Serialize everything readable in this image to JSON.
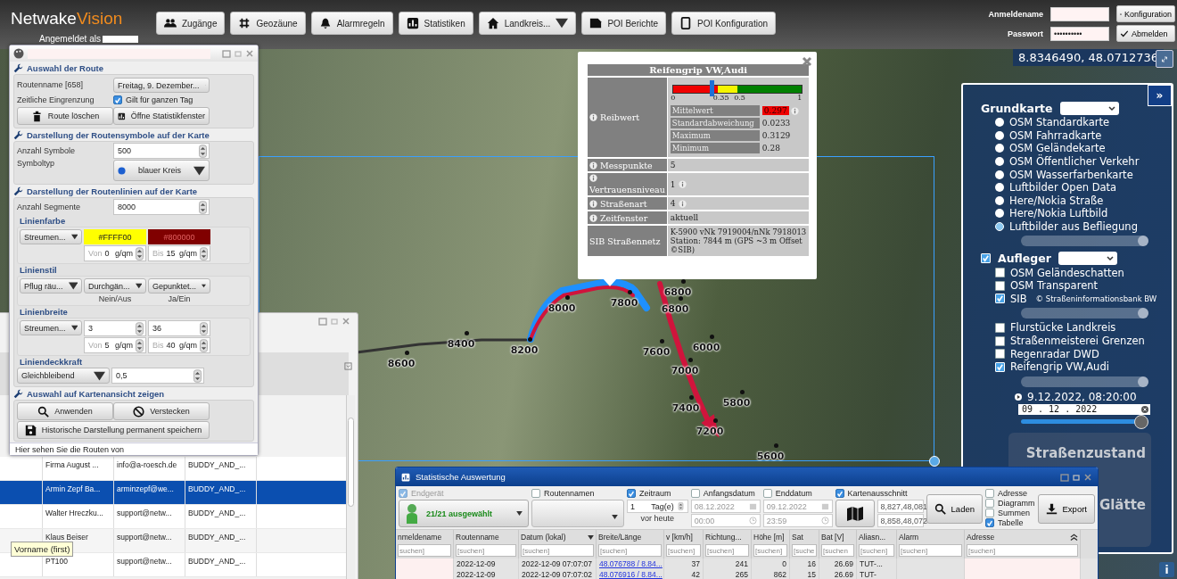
{
  "header": {
    "logo_main": "Netwake",
    "logo_accent": "Vision",
    "logged_in_label": "Angemeldet als",
    "nav": [
      {
        "label": "Zugänge",
        "dropdown": false
      },
      {
        "label": "Geozäune",
        "dropdown": false
      },
      {
        "label": "Alarmregeln",
        "dropdown": false
      },
      {
        "label": "Statistiken",
        "dropdown": false
      },
      {
        "label": "Landkreis...",
        "dropdown": true
      },
      {
        "label": "POI Berichte",
        "dropdown": false
      },
      {
        "label": "POI Konfiguration",
        "dropdown": false
      }
    ],
    "login": {
      "name_label": "Anmeldename",
      "password_label": "Passwort",
      "password_value": "••••••••••"
    },
    "buttons": [
      "Konfiguration",
      "Abmelden"
    ]
  },
  "map": {
    "coordinates": "8.8346490, 48.0712736",
    "route_labels": [
      "8600",
      "8400",
      "8200",
      "8000",
      "7800",
      "6800",
      "6800",
      "7600",
      "6000",
      "7000",
      "5800",
      "7400",
      "7200",
      "5600"
    ]
  },
  "route_panel": {
    "route_section": {
      "title": "Auswahl der Route",
      "route_name_label": "Routenname [658]",
      "route_value": "Freitag, 9. Dezember...",
      "time_label": "Zeitliche Eingrenzung",
      "whole_day": {
        "label": "Gilt für ganzen Tag",
        "checked": true
      },
      "buttons": [
        "Route löschen",
        "Öffne Statistikfenster"
      ]
    },
    "symbols_section": {
      "title": "Darstellung der Routensymbole auf der Karte",
      "count_label": "Anzahl Symbole",
      "count_value": "500",
      "type_label": "Symboltyp",
      "type_value": "blauer Kreis"
    },
    "lines_section": {
      "title": "Darstellung der Routenlinien auf der Karte",
      "segments_label": "Anzahl Segmente",
      "segments_value": "8000",
      "color": {
        "title": "Linienfarbe",
        "mode": "Streumen...",
        "from_color": "#FFFF00",
        "to_color": "#800000",
        "from": {
          "label": "Von",
          "value": "0",
          "unit": "g/qm"
        },
        "to": {
          "label": "Bis",
          "value": "15",
          "unit": "g/qm"
        }
      },
      "style": {
        "title": "Linienstil",
        "dropdowns": [
          "Pflug räu...",
          "Durchgän...",
          "Gepunktet..."
        ],
        "captions": [
          "Nein/Aus",
          "Ja/Ein"
        ]
      },
      "width": {
        "title": "Linienbreite",
        "mode": "Streumen...",
        "min_value": "3",
        "max_value": "36",
        "from": {
          "label": "Von",
          "value": "5",
          "unit": "g/qm"
        },
        "to": {
          "label": "Bis",
          "value": "40",
          "unit": "g/qm"
        }
      },
      "opacity": {
        "title": "Liniendeckkraft",
        "mode": "Gleichbleibend",
        "value": "0,5"
      }
    },
    "show_section": {
      "title": "Auswahl auf Kartenansicht zeigen",
      "buttons": [
        "Anwenden",
        "Verstecken"
      ],
      "save_button": "Historische Darstellung permanent speichern"
    },
    "footer": "Hier sehen Sie die Routen von"
  },
  "users_window": {
    "rows": [
      {
        "cells": [
          "Firma August ...",
          "info@a-roesch.de",
          "BUDDY_AND_..."
        ],
        "selected": false
      },
      {
        "cells": [
          "Armin Zepf Ba...",
          "arminzepf@we...",
          "BUDDY_AND_..."
        ],
        "selected": true
      },
      {
        "cells": [
          "Walter Hreczku...",
          "support@netw...",
          "BUDDY_AND_..."
        ],
        "selected": false
      },
      {
        "cells": [
          "Klaus Beiser",
          "support@netw...",
          "BUDDY_AND_..."
        ],
        "selected": false
      },
      {
        "cells": [
          "PT100",
          "support@netw...",
          "BUDDY_AND_..."
        ],
        "selected": false
      }
    ],
    "tooltip": "Vorname (first)"
  },
  "popup": {
    "title": "Reifengrip VW,Audi",
    "measure_label": "Reibwert",
    "gauge": {
      "ticks": [
        "0",
        "0.35",
        "0.5",
        "1"
      ],
      "level": 0.297
    },
    "stats": [
      {
        "label": "Mittelwert",
        "value": "0.297",
        "alert": true,
        "info": true
      },
      {
        "label": "Standardabweichung",
        "value": "0.0233",
        "alert": false,
        "info": false
      },
      {
        "label": "Maximum",
        "value": "0.3129",
        "alert": false,
        "info": false
      },
      {
        "label": "Minimum",
        "value": "0.28",
        "alert": false,
        "info": false
      }
    ],
    "rows": [
      {
        "label": "Messpunkte",
        "value": "5",
        "info": false
      },
      {
        "label": "Vertrauensniveau",
        "value": "1",
        "info": true
      },
      {
        "label": "Straßenart",
        "value": "4",
        "info": true
      },
      {
        "label": "Zeitfenster",
        "value": "aktuell",
        "info": false
      }
    ],
    "sib": {
      "label": "SIB Straßennetz",
      "lines": [
        "K-5900 vNk 7919004/nNk 7918013",
        "Station: 7844 m (GPS ~3 m Offset",
        "©SIB)"
      ]
    }
  },
  "layers_panel": {
    "collapse_button": "»",
    "base_title": "Grundkarte",
    "base_maps": [
      {
        "label": "OSM Standardkarte",
        "selected": false
      },
      {
        "label": "OSM Fahrradkarte",
        "selected": false
      },
      {
        "label": "OSM Geländekarte",
        "selected": false
      },
      {
        "label": "OSM Öffentlicher Verkehr",
        "selected": false
      },
      {
        "label": "OSM Wasserfarbenkarte",
        "selected": false
      },
      {
        "label": "Luftbilder Open Data",
        "selected": false
      },
      {
        "label": "Here/Nokia Straße",
        "selected": false
      },
      {
        "label": "Here/Nokia Luftbild",
        "selected": false
      },
      {
        "label": "Luftbilder aus Befliegung",
        "selected": true
      }
    ],
    "base_opacity": {
      "level": 1
    },
    "overlay_title": "Aufleger",
    "overlay_enabled": true,
    "overlays": [
      {
        "label": "OSM Geländeschatten",
        "checked": false
      },
      {
        "label": "OSM Transparent",
        "checked": false
      },
      {
        "label": "SIB",
        "note": "© Straßeninformationsbank BW",
        "checked": true,
        "level": 1
      },
      {
        "label": "Flurstücke Landkreis",
        "checked": false
      },
      {
        "label": "Straßenmeisterei Grenzen",
        "checked": false
      },
      {
        "label": "Regenradar DWD",
        "checked": false
      },
      {
        "label": "Reifengrip VW,Audi",
        "checked": true,
        "level": 1
      }
    ],
    "time": {
      "label": "9.12.2022, 08:20:00",
      "date_value": "09 . 12 . 2022",
      "level": 1
    },
    "legend": [
      "Straßenzustand",
      "Glätte"
    ]
  },
  "stats_window": {
    "title": "Statistische Auswertung",
    "device": {
      "label": "Endgerät",
      "checked": true,
      "disabled": true,
      "value": "21/21 ausgewählt"
    },
    "route_names": {
      "label": "Routennamen",
      "checked": false
    },
    "period": {
      "label": "Zeitraum",
      "checked": true,
      "value": "1",
      "unit": "Tag(e)",
      "caption": "vor heute"
    },
    "start": {
      "label": "Anfangsdatum",
      "checked": false,
      "date": "08.12.2022",
      "time": "00:00"
    },
    "end": {
      "label": "Enddatum",
      "checked": false,
      "date": "09.12.2022",
      "time": "23:59"
    },
    "extent": {
      "label": "Kartenausschnitt",
      "checked": true,
      "values": [
        "8,827,48,081",
        "8,858,48,072"
      ]
    },
    "load_button": "Laden",
    "options": [
      {
        "label": "Adresse",
        "checked": false
      },
      {
        "label": "Diagramm",
        "checked": false
      },
      {
        "label": "Summen",
        "checked": false
      },
      {
        "label": "Tabelle",
        "checked": true
      }
    ],
    "export_button": "Export",
    "columns": [
      {
        "label": "nmeldename",
        "placeholder": "suchen]",
        "sorted": false
      },
      {
        "label": "Routenname",
        "placeholder": "[suchen]",
        "sorted": false
      },
      {
        "label": "Datum (lokal)",
        "placeholder": "[suchen]",
        "sorted": true
      },
      {
        "label": "Breite/Länge",
        "placeholder": "[suchen]",
        "sorted": false
      },
      {
        "label": "v [km/h]",
        "placeholder": "[suchen]",
        "sorted": false
      },
      {
        "label": "Richtung...",
        "placeholder": "[suchen]",
        "sorted": false
      },
      {
        "label": "Höhe [m]",
        "placeholder": "[suchen]",
        "sorted": false
      },
      {
        "label": "Sat",
        "placeholder": "[suche",
        "sorted": false
      },
      {
        "label": "Bat [V]",
        "placeholder": "[suchen",
        "sorted": false
      },
      {
        "label": "Aliasn...",
        "placeholder": "[suchen]",
        "sorted": false
      },
      {
        "label": "Alarm",
        "placeholder": "[suchen]",
        "sorted": false
      },
      {
        "label": "Adresse",
        "placeholder": "[suchen]",
        "sorted": false
      }
    ],
    "rows": [
      {
        "cells": [
          "",
          "2022-12-09",
          "2022-12-09 07:07:07",
          "48.076788 / 8.84...",
          "37",
          "241",
          "0",
          "16",
          "26.69",
          "TUT-...",
          "",
          ""
        ]
      },
      {
        "cells": [
          "",
          "2022-12-09",
          "2022-12-09 07:07:02",
          "48.076916 / 8.84...",
          "42",
          "265",
          "862",
          "15",
          "26.69",
          "TUT-",
          "",
          ""
        ]
      }
    ]
  },
  "info_button": "i"
}
